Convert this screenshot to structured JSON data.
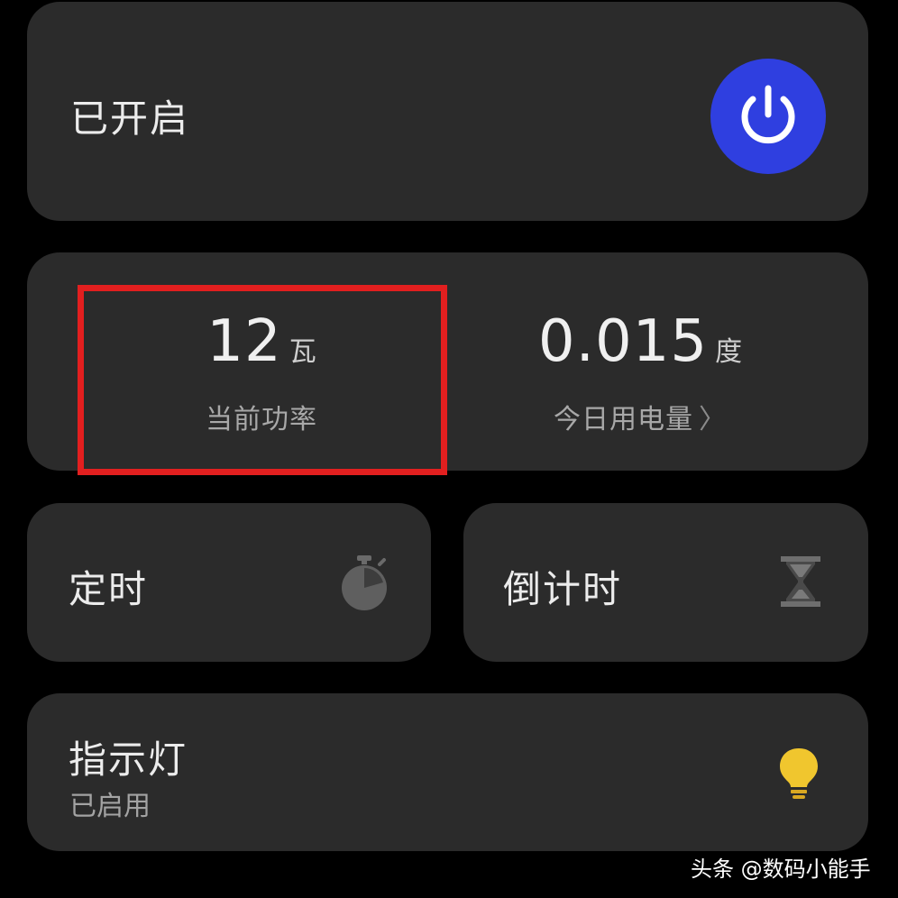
{
  "power_card": {
    "status_label": "已开启",
    "power_button_color": "#2f3fe0",
    "power_icon": "power-icon"
  },
  "stats_card": {
    "current_power": {
      "value": "12",
      "unit": "瓦",
      "label": "当前功率"
    },
    "today_usage": {
      "value": "0.015",
      "unit": "度",
      "label": "今日用电量",
      "chevron": "〉"
    },
    "highlight_color": "#e21f1f"
  },
  "timer_card": {
    "label": "定时",
    "icon": "stopwatch-icon"
  },
  "countdown_card": {
    "label": "倒计时",
    "icon": "hourglass-icon"
  },
  "indicator_card": {
    "label": "指示灯",
    "status": "已启用",
    "icon": "lightbulb-icon",
    "icon_color": "#f0c62e"
  },
  "watermark": {
    "text": "头条 @数码小能手"
  }
}
